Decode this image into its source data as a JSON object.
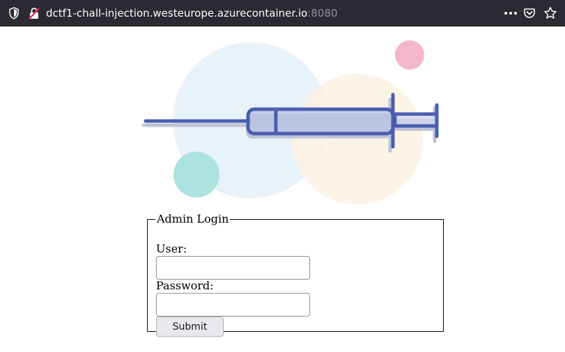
{
  "browser": {
    "url_host": "dctf1-chall-injection.westeurope.azurecontainer.io",
    "url_port": ":8080",
    "icons": [
      "shield-icon",
      "insecure-connection-icon",
      "page-actions-menu-icon",
      "pocket-icon",
      "bookmark-star-icon"
    ]
  },
  "hero": {
    "image": "syringe-illustration",
    "colors": {
      "circle_blue": "#e8f2f9",
      "circle_peach": "#fdf2e4",
      "circle_pink": "#f3b6cc",
      "circle_teal": "#ace3e1",
      "syringe": "#4a5eb0",
      "syringe_shadow": "#bfc3d6",
      "fluid": "#b9c6e6"
    }
  },
  "form": {
    "legend": "Admin Login",
    "user_label": "User:",
    "user_value": "",
    "password_label": "Password:",
    "password_value": "",
    "submit_label": "Submit"
  }
}
